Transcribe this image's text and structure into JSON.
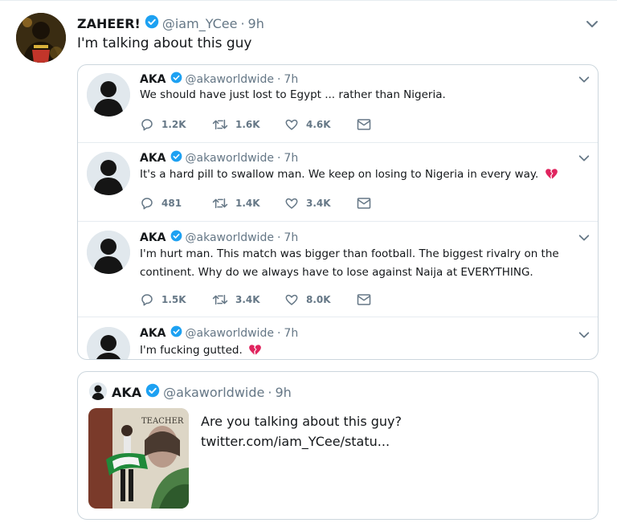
{
  "main_tweet": {
    "display_name": "ZAHEER!",
    "handle": "@iam_YCee",
    "time": "9h",
    "text": "I'm talking about this guy"
  },
  "thread": [
    {
      "display_name": "AKA",
      "handle": "@akaworldwide",
      "time": "7h",
      "text": "We should have just lost to Egypt ... rather than Nigeria.",
      "replies": "1.2K",
      "retweets": "1.6K",
      "likes": "4.6K"
    },
    {
      "display_name": "AKA",
      "handle": "@akaworldwide",
      "time": "7h",
      "text": "It's a hard pill to swallow man. We keep on losing to Nigeria in every way.",
      "emoji": "broken-heart",
      "replies": "481",
      "retweets": "1.4K",
      "likes": "3.4K"
    },
    {
      "display_name": "AKA",
      "handle": "@akaworldwide",
      "time": "7h",
      "text_line1": "I'm hurt man. This match was bigger than football. The biggest rivalry on the",
      "text_line2": "continent. Why do we always have to lose against Naija at EVERYTHING.",
      "replies": "1.5K",
      "retweets": "3.4K",
      "likes": "8.0K"
    },
    {
      "display_name": "AKA",
      "handle": "@akaworldwide",
      "time": "7h",
      "text": "I'm fucking gutted.",
      "emoji": "broken-heart"
    }
  ],
  "quoted": {
    "display_name": "AKA",
    "handle": "@akaworldwide",
    "time": "9h",
    "text_line1": "Are you talking about this guy?",
    "text_line2": "twitter.com/iam_YCee/statu...",
    "photo_sign": "TEACHER"
  },
  "colors": {
    "verified_blue": "#1da1f2",
    "heart_red": "#e0245e",
    "muted": "#657786",
    "border": "#ccd6dd"
  },
  "icons": [
    "verified-badge-icon",
    "chevron-down-icon",
    "reply-icon",
    "retweet-icon",
    "like-icon",
    "direct-message-icon",
    "broken-heart-icon"
  ]
}
